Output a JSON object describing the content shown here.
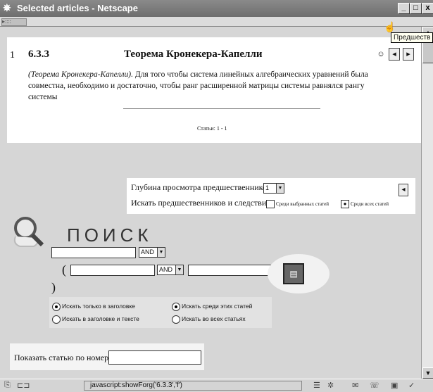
{
  "window": {
    "app_icon": "netscape-icon",
    "title": "Selected articles - Netscape",
    "buttons": {
      "minimize": "_",
      "maximize": "□",
      "close": "x"
    }
  },
  "article": {
    "index": "1",
    "code": "6.3.3",
    "title": "Теорема Кронекера-Капелли",
    "lead": "(Теорема Кронекера-Капелли).",
    "body": "Для того чтобы система линейных алгебраических уравнений была совместна, необходимо и достаточно, чтобы ранг расширенной матрицы системы равнялся рангу системы",
    "stats": "Статьи: 1 - 1",
    "tooltip": "Предшеств"
  },
  "predecessors": {
    "depth_label": "Глубина просмотра предшественников:",
    "depth_value": "1",
    "search_label": "Искать предшественников и следствия",
    "option_selected": "Среди выбранных статей",
    "option_all": "Среди всех статей"
  },
  "search": {
    "title": "ПОИСК",
    "op1": "AND",
    "op2": "AND",
    "open_paren": "(",
    "close_paren": ")",
    "options": {
      "title_only": "Искать только в заголовке",
      "title_and_text": "Искать в заголовке и тексте",
      "among_these": "Искать среди этих статей",
      "among_all": "Искать во всех статьях"
    }
  },
  "show_article": {
    "label": "Показать статью по номеру:"
  },
  "status": {
    "text": "javascript:showForg('6.3.3','f')"
  }
}
